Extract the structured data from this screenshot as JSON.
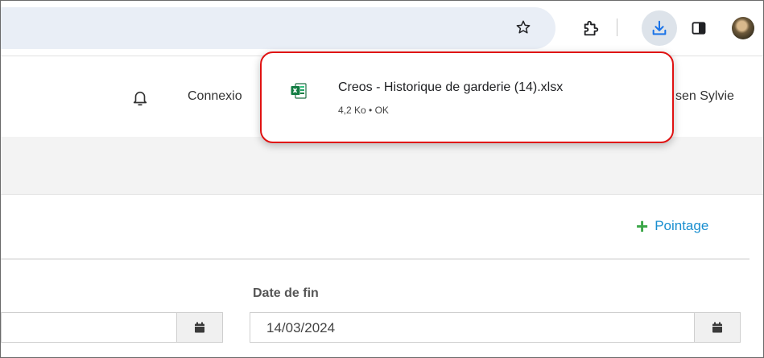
{
  "browser": {
    "icons": [
      "star-icon",
      "puzzle-icon",
      "download-icon",
      "side-panel-icon",
      "avatar"
    ]
  },
  "header": {
    "connexion_label": "Connexio",
    "user_name": "sen Sylvie"
  },
  "actions": {
    "pointage_label": "Pointage"
  },
  "form": {
    "end_date_label": "Date de fin",
    "start_date_value": "",
    "end_date_value": "14/03/2024"
  },
  "download": {
    "file_name": "Creos - Historique de garderie (14).xlsx",
    "file_meta": "4,2 Ko • OK"
  },
  "colors": {
    "accent_link": "#1a8fd0",
    "plus_green": "#3aa647",
    "highlight_red": "#e01212",
    "download_blue": "#1a73e8",
    "excel_green": "#1e7145"
  }
}
